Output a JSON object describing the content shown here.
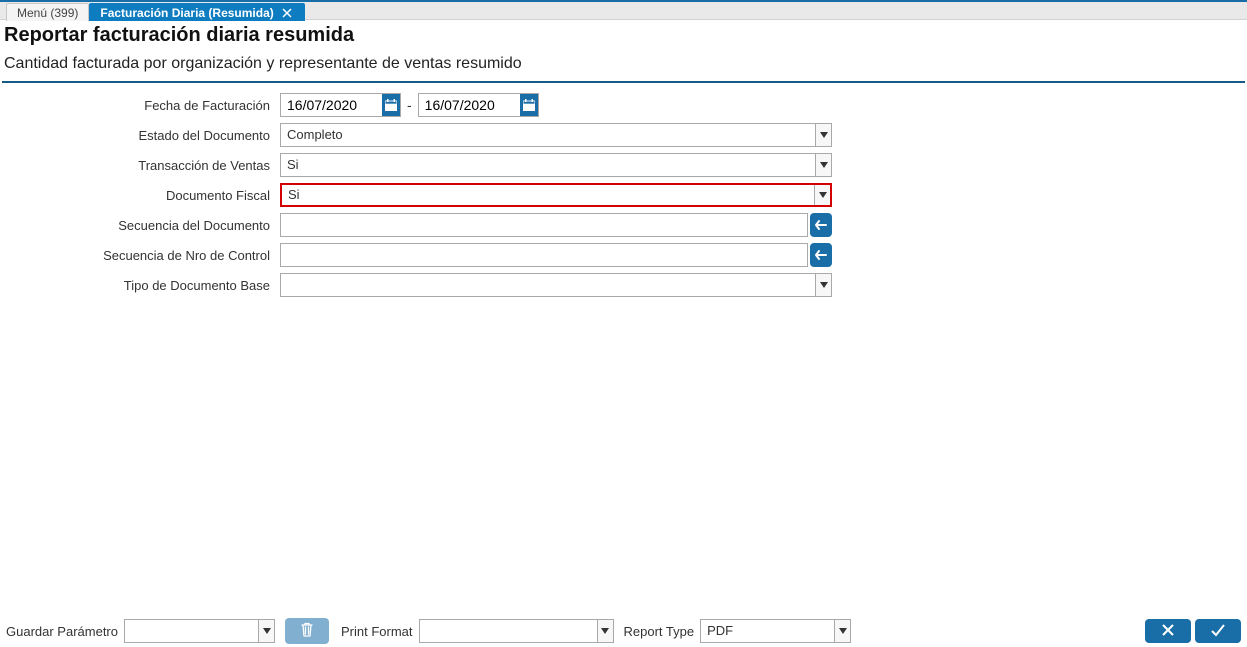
{
  "tabs": {
    "menu_label": "Menú (399)",
    "active_label": "Facturación Diaria (Resumida)"
  },
  "header": {
    "title": "Reportar facturación diaria resumida",
    "subtitle": "Cantidad facturada por organización y representante de ventas resumido"
  },
  "form": {
    "labels": {
      "fecha": "Fecha de Facturación",
      "estado": "Estado del Documento",
      "transaccion": "Transacción de Ventas",
      "fiscal": "Documento Fiscal",
      "secuencia_doc": "Secuencia del Documento",
      "secuencia_control": "Secuencia de Nro de Control",
      "tipo_base": "Tipo de Documento Base"
    },
    "values": {
      "fecha_from": "16/07/2020",
      "fecha_to": "16/07/2020",
      "estado": "Completo",
      "transaccion": "Si",
      "fiscal": "Si",
      "secuencia_doc": "",
      "secuencia_control": "",
      "tipo_base": ""
    }
  },
  "footer": {
    "guardar_label": "Guardar Parámetro",
    "guardar_value": "",
    "print_label": "Print Format",
    "print_value": "",
    "report_label": "Report Type",
    "report_value": "PDF"
  }
}
